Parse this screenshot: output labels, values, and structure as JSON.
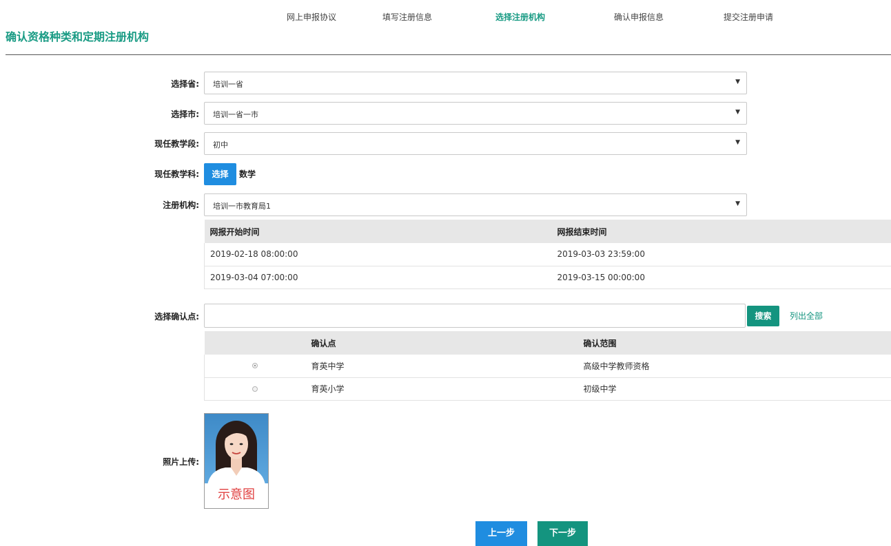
{
  "steps": [
    {
      "label": "网上申报协议",
      "active": false
    },
    {
      "label": "填写注册信息",
      "active": false
    },
    {
      "label": "选择注册机构",
      "active": true
    },
    {
      "label": "确认申报信息",
      "active": false
    },
    {
      "label": "提交注册申请",
      "active": false
    }
  ],
  "page_title": "确认资格种类和定期注册机构",
  "form": {
    "province": {
      "label": "选择省:",
      "value": "培训一省"
    },
    "city": {
      "label": "选择市:",
      "value": "培训一省一市"
    },
    "stage": {
      "label": "现任教学段:",
      "value": "初中"
    },
    "subject": {
      "label": "现任教学科:",
      "button_label": "选择",
      "value": "数学"
    },
    "institution": {
      "label": "注册机构:",
      "value": "培训一市教育局1"
    }
  },
  "period_table": {
    "headers": [
      "网报开始时间",
      "网报结束时间"
    ],
    "rows": [
      [
        "2019-02-18 08:00:00",
        "2019-03-03 23:59:00"
      ],
      [
        "2019-03-04 07:00:00",
        "2019-03-15 00:00:00"
      ]
    ]
  },
  "confirm_point": {
    "label": "选择确认点:",
    "input_value": "",
    "search_label": "搜索",
    "list_all_label": "列出全部",
    "table": {
      "headers": [
        "",
        "确认点",
        "确认范围"
      ],
      "rows": [
        {
          "selected": true,
          "name": "育英中学",
          "scope": "高级中学教师资格"
        },
        {
          "selected": false,
          "name": "育英小学",
          "scope": "初级中学"
        }
      ]
    }
  },
  "photo": {
    "label": "照片上传:",
    "caption": "示意图"
  },
  "nav": {
    "prev_label": "上一步",
    "next_label": "下一步"
  },
  "colors": {
    "accent_green": "#14947f",
    "accent_blue": "#1f8de0"
  },
  "icons": {
    "select_arrow": "triangle-down",
    "radio": "radio-button"
  }
}
